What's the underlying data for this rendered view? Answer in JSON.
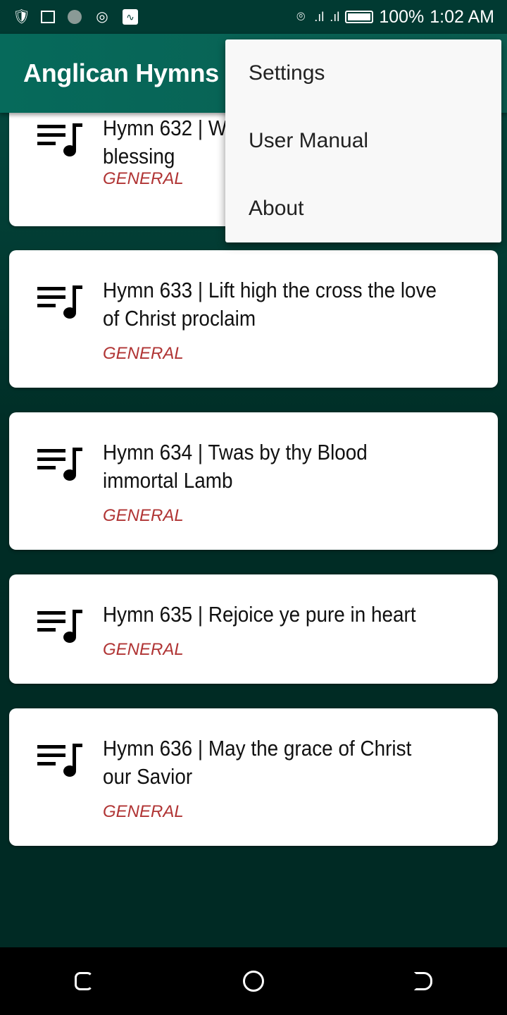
{
  "status_bar": {
    "battery": "100%",
    "time": "1:02 AM",
    "left_icons": [
      "shield-check-icon",
      "cast-icon",
      "loading-icon",
      "target-icon",
      "activity-icon"
    ],
    "right_icons": [
      "hotspot-icon",
      "signal-icon",
      "signal-icon",
      "battery-icon"
    ]
  },
  "app_bar": {
    "title": "Anglican Hymns"
  },
  "menu": {
    "items": [
      "Settings",
      "User Manual",
      "About"
    ]
  },
  "hymns": [
    {
      "title_line1": "Hymn 632 | W",
      "title_line2": "blessing",
      "category": "GENERAL"
    },
    {
      "title": "Hymn 633 | Lift high the cross the love of Christ proclaim",
      "category": "GENERAL"
    },
    {
      "title": "Hymn 634 | Twas by thy Blood immortal Lamb",
      "category": "GENERAL"
    },
    {
      "title": "Hymn 635 | Rejoice ye pure in heart",
      "category": "GENERAL"
    },
    {
      "title": "Hymn 636 | May the grace of Christ our Savior",
      "category": "GENERAL"
    }
  ],
  "colors": {
    "app_bar": "#066a5b",
    "category": "#b03434",
    "background": "#003029"
  }
}
